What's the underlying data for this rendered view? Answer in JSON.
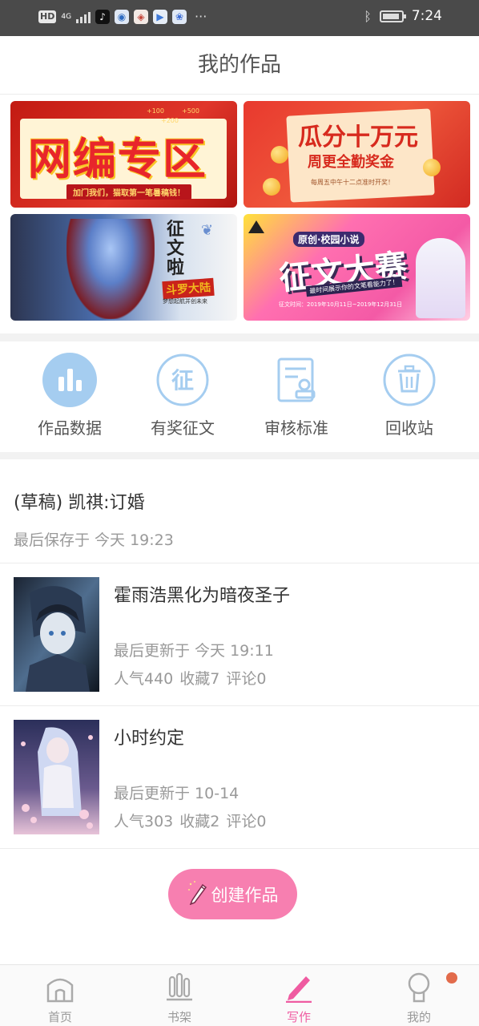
{
  "status_bar": {
    "hd": "HD",
    "network": "4G",
    "dots": "···",
    "time": "7:24"
  },
  "header": {
    "title": "我的作品"
  },
  "banners": {
    "b1": {
      "title": "网编专区",
      "subtitle": "加门我们，猫取第一笔暑稿钱！",
      "bonus1": "+100",
      "bonus2": "+200",
      "bonus3": "+500"
    },
    "b2": {
      "title": "瓜分十万元",
      "subtitle": "周更全勤奖金",
      "note": "每周五中午十二点准时开奖！"
    },
    "b3": {
      "char1": "征",
      "char2": "文",
      "char3": "啦",
      "tag": "斗罗大陆",
      "note": "梦想起航并创未来"
    },
    "b4": {
      "header": "原创·校园小说",
      "title": "征文大赛",
      "ribbon": "最时间展示你的文笔看能力了！",
      "note": "征文时间：2019年10月11日~2019年12月31日"
    }
  },
  "menu": [
    {
      "label": "作品数据",
      "icon": "bar-chart-icon"
    },
    {
      "label": "有奖征文",
      "icon": "contest-icon"
    },
    {
      "label": "审核标准",
      "icon": "review-standard-icon"
    },
    {
      "label": "回收站",
      "icon": "trash-icon"
    }
  ],
  "draft": {
    "title": "(草稿) 凯祺:订婚",
    "saved": "最后保存于 今天 19:23"
  },
  "works": [
    {
      "title": "霍雨浩黑化为暗夜圣子",
      "updated": "最后更新于 今天 19:11",
      "popularity": "人气440",
      "favorites": "收藏7",
      "comments": "评论0"
    },
    {
      "title": "小时约定",
      "updated": "最后更新于 10-14",
      "popularity": "人气303",
      "favorites": "收藏2",
      "comments": "评论0"
    }
  ],
  "create_button": {
    "label": "创建作品"
  },
  "tabs": [
    {
      "label": "首页",
      "icon": "home-icon"
    },
    {
      "label": "书架",
      "icon": "bookshelf-icon"
    },
    {
      "label": "写作",
      "icon": "pen-icon"
    },
    {
      "label": "我的",
      "icon": "profile-icon"
    }
  ],
  "colors": {
    "accent": "#f77fb0",
    "menu_icon": "#a5cdf0",
    "active_tab": "#ef5ba1",
    "badge": "#e26b4b"
  }
}
